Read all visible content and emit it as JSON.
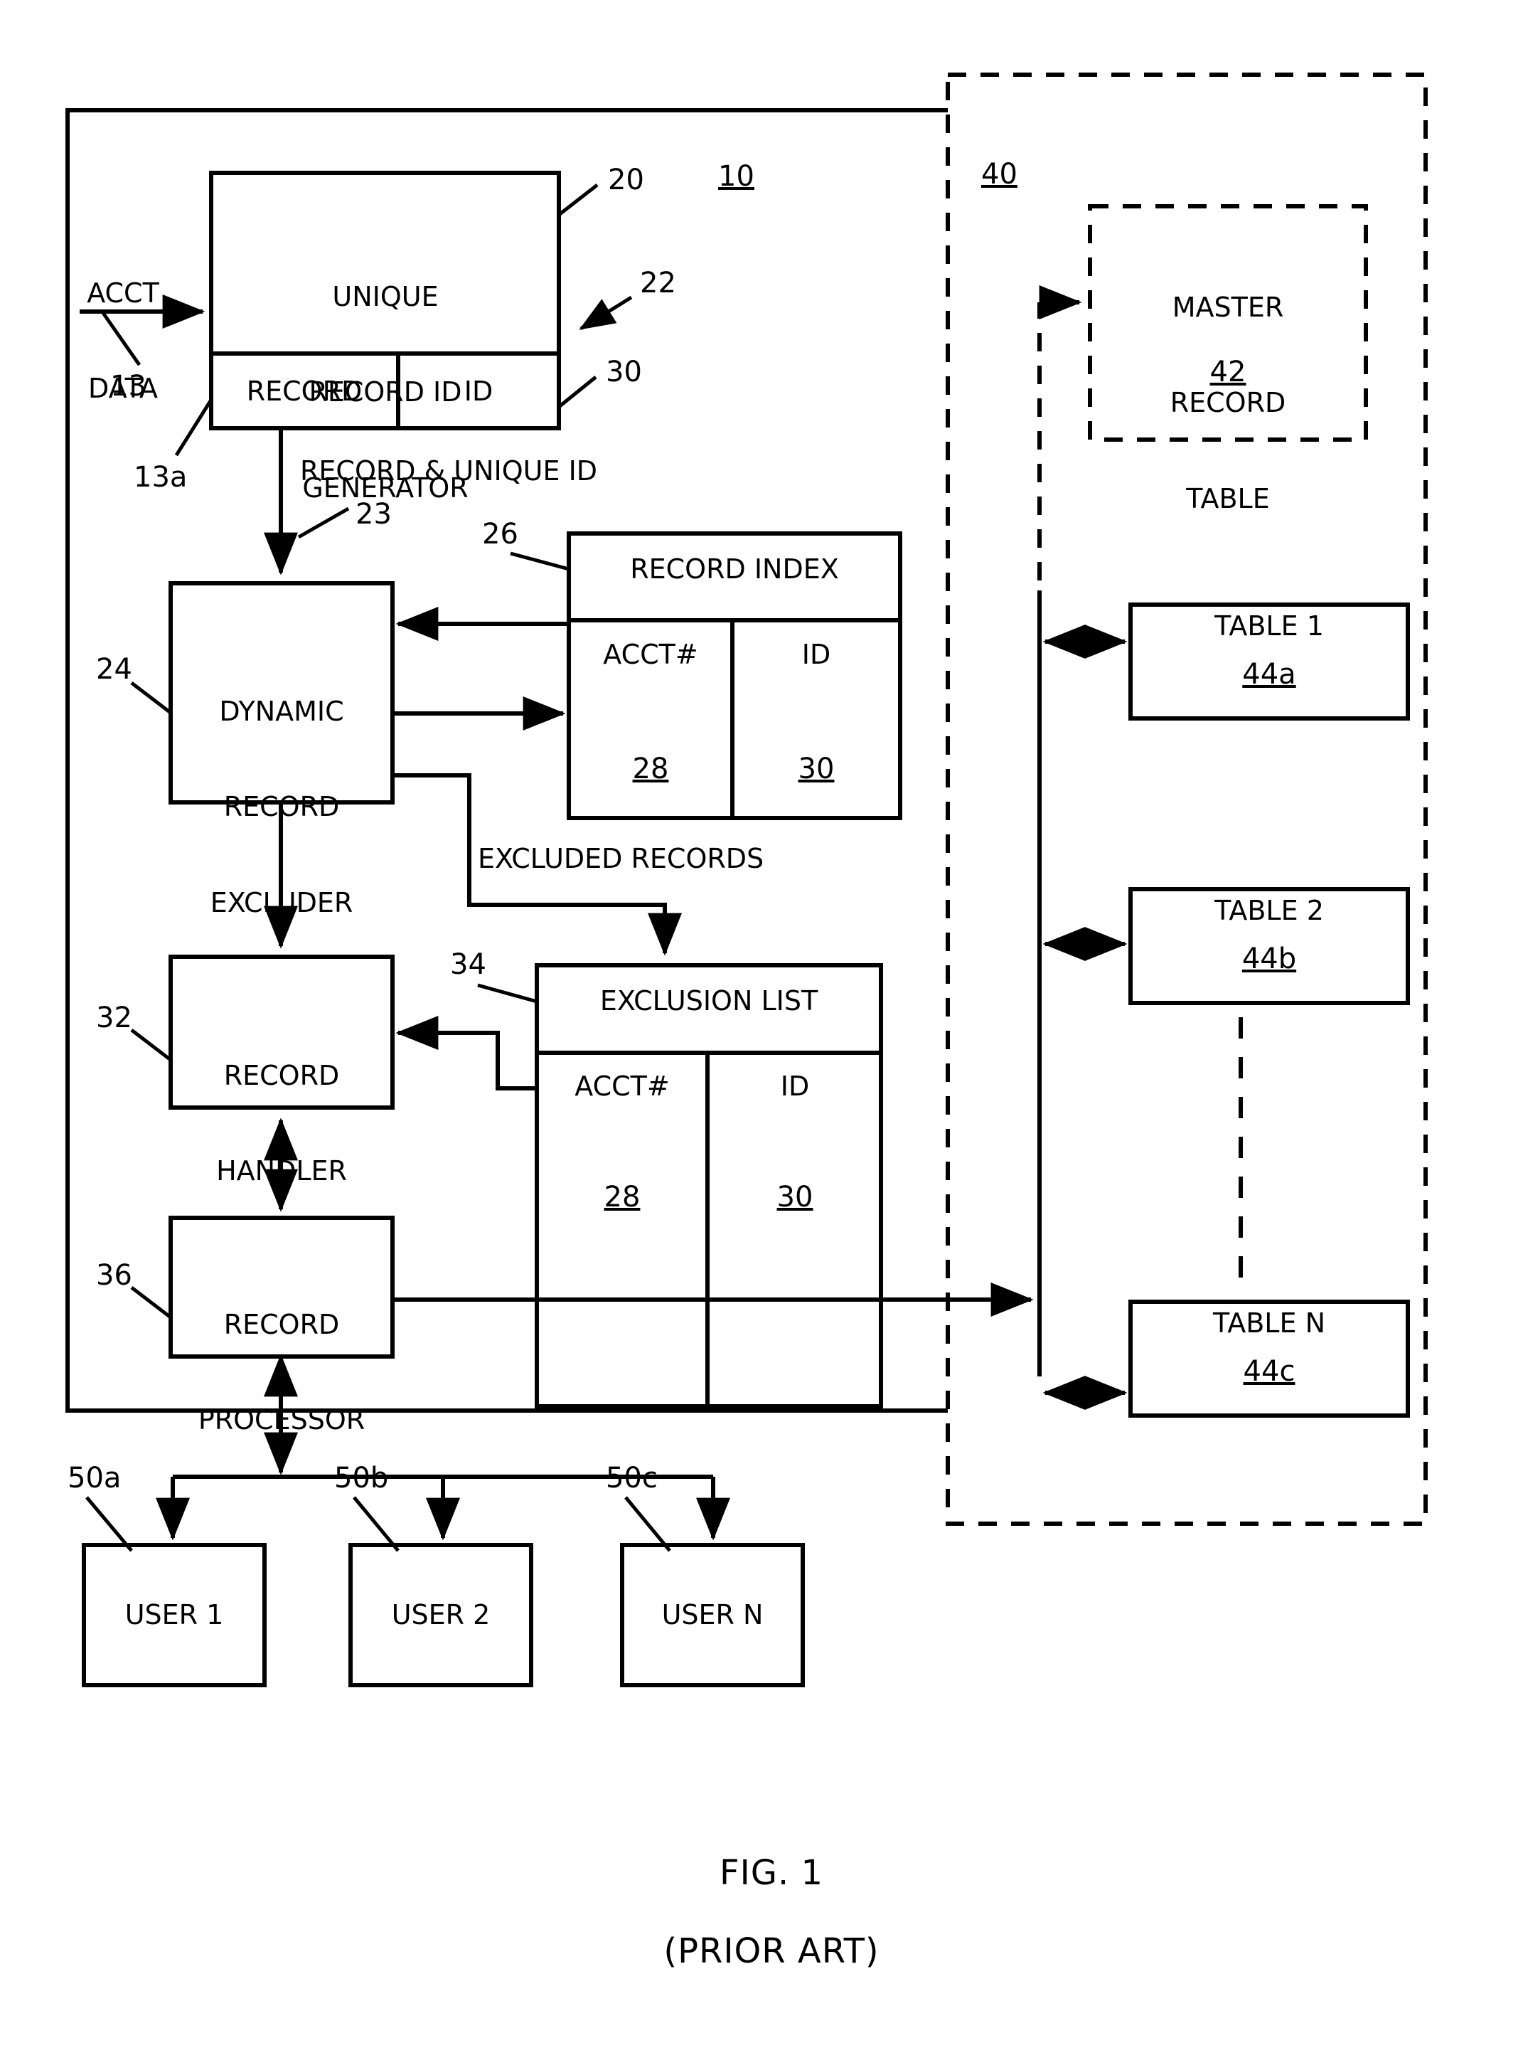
{
  "figure": {
    "caption_line1": "FIG. 1",
    "caption_line2": "(PRIOR ART)"
  },
  "system": {
    "ref": "10",
    "database_ref": "40"
  },
  "inputs": {
    "acct_data_line1": "ACCT",
    "acct_data_line2": "DATA",
    "acct_data_ref": "13",
    "record_field_ref": "13a"
  },
  "blocks": {
    "generator": {
      "line1": "UNIQUE",
      "line2": "RECORD ID",
      "line3": "GENERATOR",
      "ref": "20",
      "arrow_ref": "22",
      "cell_record": "RECORD",
      "cell_id": "ID",
      "cell_id_ref": "30"
    },
    "excluder": {
      "line1": "DYNAMIC",
      "line2": "RECORD",
      "line3": "EXCLUDER",
      "ref": "24"
    },
    "handler": {
      "line1": "RECORD",
      "line2": "HANDLER",
      "ref": "32"
    },
    "processor": {
      "line1": "RECORD",
      "line2": "PROCESSOR",
      "ref": "36"
    }
  },
  "tables": {
    "record_index": {
      "title": "RECORD INDEX",
      "ref": "26",
      "col1_header": "ACCT#",
      "col1_ref": "28",
      "col2_header": "ID",
      "col2_ref": "30"
    },
    "exclusion_list": {
      "title": "EXCLUSION LIST",
      "ref": "34",
      "col1_header": "ACCT#",
      "col1_ref": "28",
      "col2_header": "ID",
      "col2_ref": "30"
    }
  },
  "database": {
    "master_record_table": {
      "line1": "MASTER",
      "line2": "RECORD",
      "line3": "TABLE",
      "ref": "42"
    },
    "table_list": [
      {
        "label": "TABLE 1",
        "ref": "44a"
      },
      {
        "label": "TABLE 2",
        "ref": "44b"
      },
      {
        "label": "TABLE N",
        "ref": "44c"
      }
    ]
  },
  "flow_labels": {
    "record_and_unique_id": "RECORD & UNIQUE ID",
    "record_and_unique_id_ref": "23",
    "excluded_records": "EXCLUDED RECORDS"
  },
  "users": [
    {
      "label": "USER 1",
      "ref": "50a"
    },
    {
      "label": "USER 2",
      "ref": "50b"
    },
    {
      "label": "USER N",
      "ref": "50c"
    }
  ],
  "colors": {
    "stroke": "#000000",
    "background": "#ffffff"
  }
}
